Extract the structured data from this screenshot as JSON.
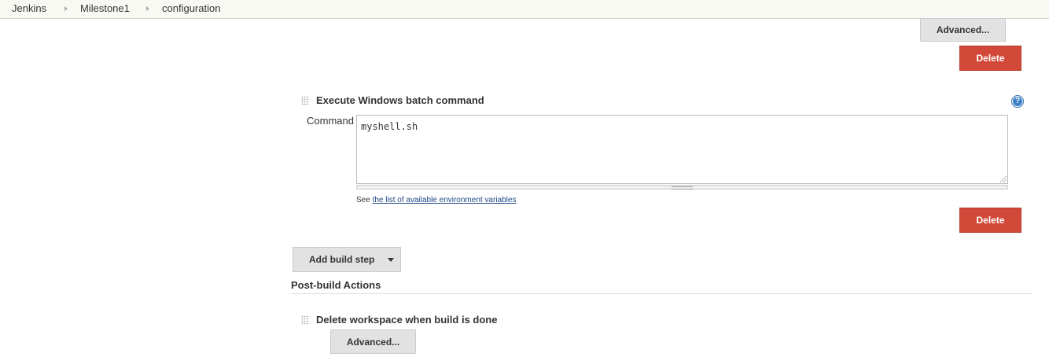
{
  "breadcrumb": {
    "items": [
      "Jenkins",
      "Milestone1",
      "configuration"
    ]
  },
  "top_section": {
    "advanced_label": "Advanced...",
    "delete_label": "Delete"
  },
  "build_step": {
    "title": "Execute Windows batch command",
    "command_label": "Command",
    "command_value": "myshell.sh",
    "env_hint_prefix": "See",
    "env_hint_link": "the list of available environment variables",
    "delete_label": "Delete",
    "help_glyph": "?"
  },
  "add_build_step_label": "Add build step",
  "post_build": {
    "heading": "Post-build Actions",
    "step_title": "Delete workspace when build is done",
    "advanced_label": "Advanced..."
  },
  "colors": {
    "delete_button": "#d24939",
    "breadcrumb_bg": "#f9f9f4",
    "link": "#204a87",
    "help_icon": "#3b7fc4"
  }
}
